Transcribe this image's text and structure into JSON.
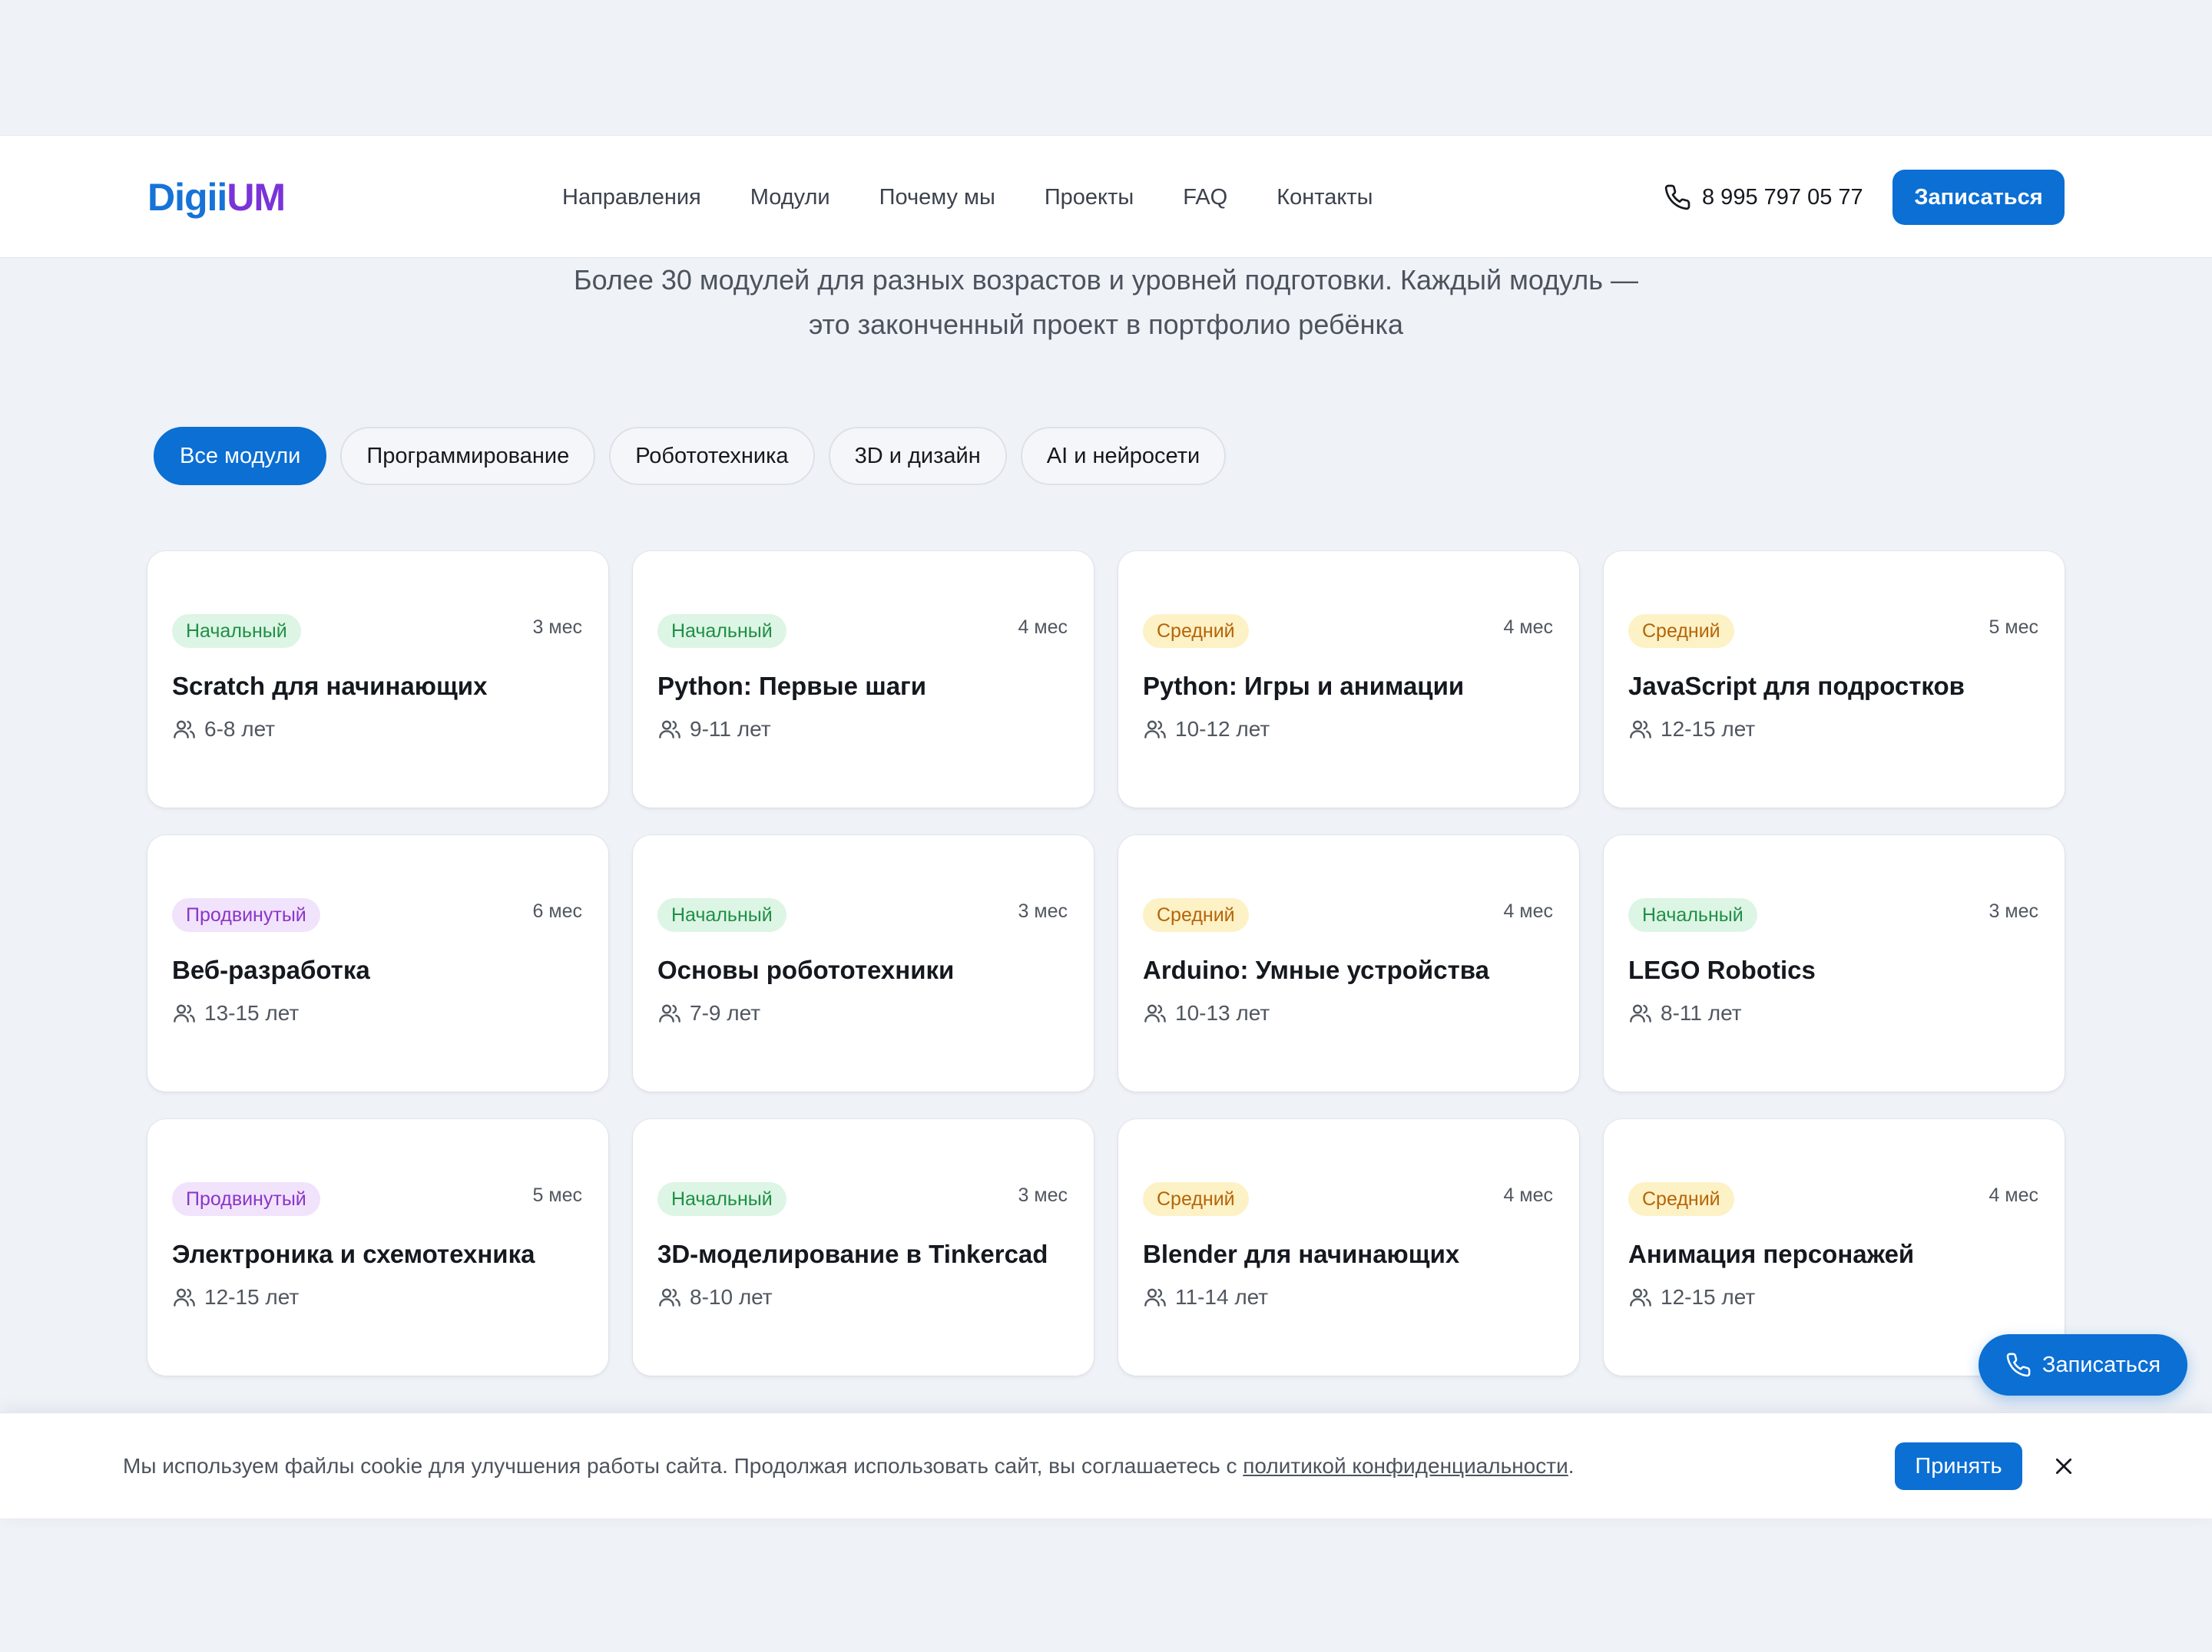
{
  "header": {
    "logo_part1": "Digii",
    "logo_part2": "UM",
    "nav": [
      "Направления",
      "Модули",
      "Почему мы",
      "Проекты",
      "FAQ",
      "Контакты"
    ],
    "phone": "8 995 797 05 77",
    "phone_icon": "phone-icon",
    "cta_label": "Записаться"
  },
  "intro": {
    "subtitle_line1": "Более 30 модулей для разных возрастов и уровней подготовки. Каждый модуль —",
    "subtitle_line2": "это законченный проект в портфолио ребёнка"
  },
  "filters": {
    "active_index": 0,
    "items": [
      "Все модули",
      "Программирование",
      "Робототехника",
      "3D и дизайн",
      "AI и нейросети"
    ]
  },
  "modules": [
    {
      "level": "Начальный",
      "level_key": "beginner",
      "duration": "3 мес",
      "title": "Scratch для начинающих",
      "ages": "6-8 лет"
    },
    {
      "level": "Начальный",
      "level_key": "beginner",
      "duration": "4 мес",
      "title": "Python: Первые шаги",
      "ages": "9-11 лет"
    },
    {
      "level": "Средний",
      "level_key": "middle",
      "duration": "4 мес",
      "title": "Python: Игры и анимации",
      "ages": "10-12 лет"
    },
    {
      "level": "Средний",
      "level_key": "middle",
      "duration": "5 мес",
      "title": "JavaScript для подростков",
      "ages": "12-15 лет"
    },
    {
      "level": "Продвинутый",
      "level_key": "advanced",
      "duration": "6 мес",
      "title": "Веб-разработка",
      "ages": "13-15 лет"
    },
    {
      "level": "Начальный",
      "level_key": "beginner",
      "duration": "3 мес",
      "title": "Основы робототехники",
      "ages": "7-9 лет"
    },
    {
      "level": "Средний",
      "level_key": "middle",
      "duration": "4 мес",
      "title": "Arduino: Умные устройства",
      "ages": "10-13 лет"
    },
    {
      "level": "Начальный",
      "level_key": "beginner",
      "duration": "3 мес",
      "title": "LEGO Robotics",
      "ages": "8-11 лет"
    },
    {
      "level": "Продвинутый",
      "level_key": "advanced",
      "duration": "5 мес",
      "title": "Электроника и схемотехника",
      "ages": "12-15 лет"
    },
    {
      "level": "Начальный",
      "level_key": "beginner",
      "duration": "3 мес",
      "title": "3D-моделирование в Tinkercad",
      "ages": "8-10 лет"
    },
    {
      "level": "Средний",
      "level_key": "middle",
      "duration": "4 мес",
      "title": "Blender для начинающих",
      "ages": "11-14 лет"
    },
    {
      "level": "Средний",
      "level_key": "middle",
      "duration": "4 мес",
      "title": "Анимация персонажей",
      "ages": "12-15 лет"
    }
  ],
  "floating_cta": {
    "label": "Записаться",
    "icon": "phone-icon"
  },
  "cookie": {
    "text": "Мы используем файлы cookie для улучшения работы сайта. Продолжая использовать сайт, вы соглашаетесь с ",
    "link_text": "политикой конфиденциальности",
    "suffix": ".",
    "accept_label": "Принять",
    "close_icon": "close-icon"
  },
  "colors": {
    "primary": "#0b6fd4",
    "logo_blue": "#1673d8",
    "logo_purple": "#7a33d8",
    "level_beginner": "#1f8f47",
    "level_middle": "#b46508",
    "level_advanced": "#8a36c9"
  }
}
